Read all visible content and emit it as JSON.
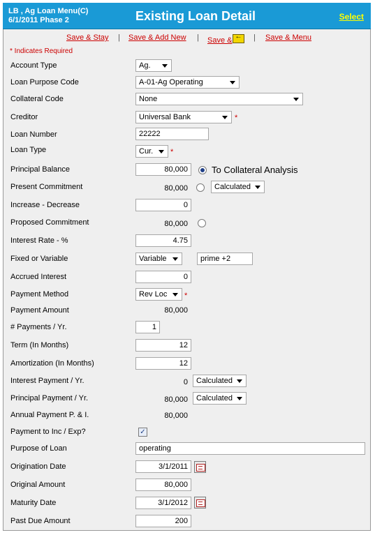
{
  "header": {
    "line1": "LB , Ag Loan Menu(C)",
    "line2": "6/1/2011 Phase 2",
    "title": "Existing Loan Detail",
    "select_label": "Select"
  },
  "actions": {
    "save_stay": "Save & Stay",
    "save_add_new": "Save & Add New",
    "save_amp": "Save &",
    "save_menu": "Save & Menu",
    "separator": "|"
  },
  "required_note": "* Indicates Required",
  "required_mark": "*",
  "fields": {
    "account_type": {
      "label": "Account Type",
      "value": "Ag."
    },
    "loan_purpose_code": {
      "label": "Loan Purpose Code",
      "value": "A-01-Ag Operating"
    },
    "collateral_code": {
      "label": "Collateral Code",
      "value": "None"
    },
    "creditor": {
      "label": "Creditor",
      "value": "Universal Bank"
    },
    "loan_number": {
      "label": "Loan Number",
      "value": "22222"
    },
    "loan_type": {
      "label": "Loan Type",
      "value": "Cur."
    },
    "principal_balance": {
      "label": "Principal Balance",
      "value": "80,000",
      "radio_label": "To Collateral Analysis"
    },
    "present_commitment": {
      "label": "Present Commitment",
      "value": "80,000",
      "select": "Calculated"
    },
    "increase_decrease": {
      "label": "Increase - Decrease",
      "value": "0"
    },
    "proposed_commitment": {
      "label": "Proposed Commitment",
      "value": "80,000"
    },
    "interest_rate": {
      "label": "Interest Rate - %",
      "value": "4.75"
    },
    "fixed_variable": {
      "label": "Fixed or Variable",
      "value": "Variable",
      "note": "prime +2"
    },
    "accrued_interest": {
      "label": "Accrued Interest",
      "value": "0"
    },
    "payment_method": {
      "label": "Payment Method",
      "value": "Rev Loc"
    },
    "payment_amount": {
      "label": "Payment Amount",
      "value": "80,000"
    },
    "payments_per_yr": {
      "label": "# Payments / Yr.",
      "value": "1"
    },
    "term": {
      "label": "Term (In Months)",
      "value": "12"
    },
    "amortization": {
      "label": "Amortization (In Months)",
      "value": "12"
    },
    "interest_payment": {
      "label": "Interest Payment / Yr.",
      "value": "0",
      "select": "Calculated"
    },
    "principal_payment": {
      "label": "Principal Payment / Yr.",
      "value": "80,000",
      "select": "Calculated"
    },
    "annual_payment": {
      "label": "Annual Payment P. & I.",
      "value": "80,000"
    },
    "payment_inc_exp": {
      "label": "Payment to Inc / Exp?",
      "checked": "✓"
    },
    "purpose": {
      "label": "Purpose of Loan",
      "value": "operating"
    },
    "origination_date": {
      "label": "Origination Date",
      "value": "3/1/2011"
    },
    "original_amount": {
      "label": "Original Amount",
      "value": "80,000"
    },
    "maturity_date": {
      "label": "Maturity Date",
      "value": "3/1/2012"
    },
    "past_due_amount": {
      "label": "Past Due Amount",
      "value": "200"
    }
  }
}
